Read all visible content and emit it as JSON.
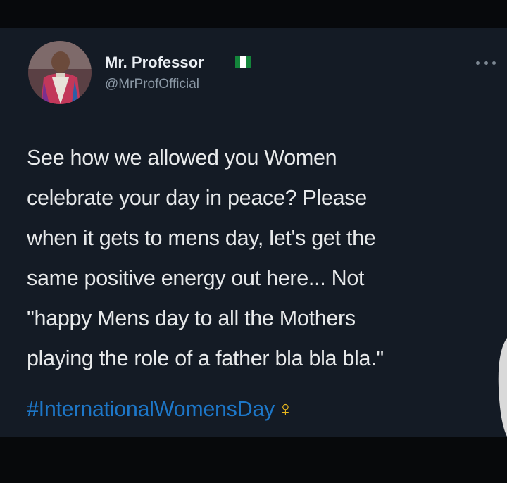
{
  "tweet": {
    "display_name": "Mr. Professor",
    "handle": "@MrProfOfficial",
    "flag_icon": "nigeria-flag-icon",
    "more_icon": "ellipsis-icon",
    "text_lines": [
      "See how we allowed you Women",
      "celebrate your day in peace? Please",
      "when it gets to mens day, let's get the",
      "same positive energy out here... Not",
      "\"happy Mens day to all the Mothers",
      "playing the role of a father bla bla bla.\""
    ],
    "hashtag": "#InternationalWomensDay",
    "emoji": "♀",
    "emoji_name": "female-sign-icon"
  },
  "colors": {
    "card_background": "#141b25",
    "text": "#e7e9ea",
    "handle": "#8b98a5",
    "hashtag": "#1d77c8",
    "female_sign": "#e9b81e",
    "flag_green": "#14853b",
    "flag_white": "#ffffff"
  }
}
